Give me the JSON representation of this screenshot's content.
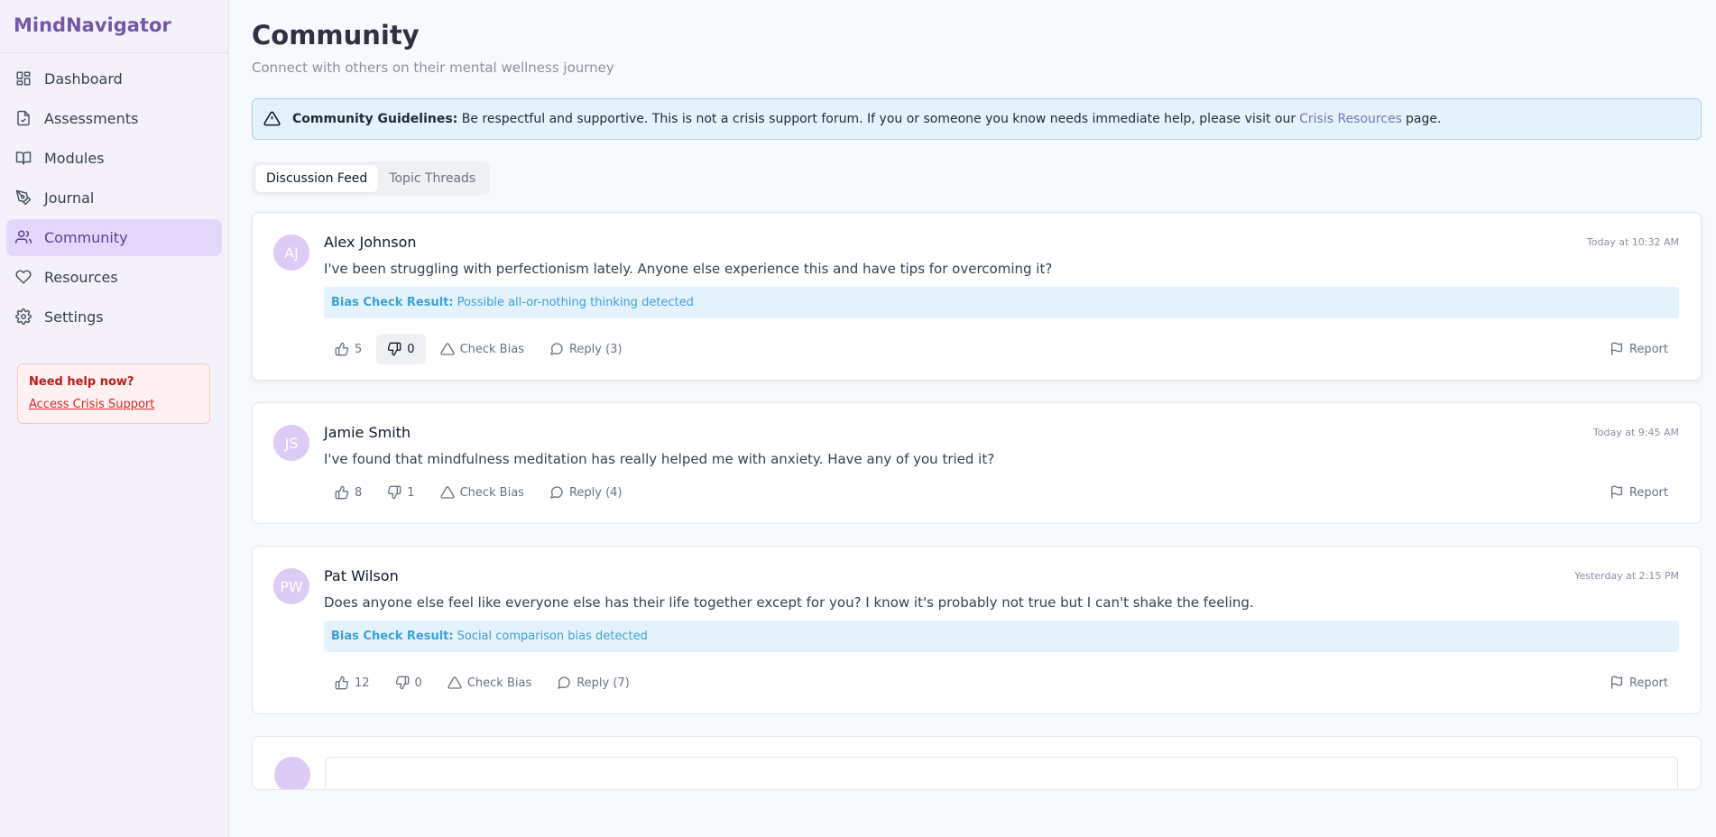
{
  "app": {
    "name": "MindNavigator"
  },
  "sidebar": {
    "items": [
      {
        "label": "Dashboard",
        "icon": "dashboard-icon",
        "active": false
      },
      {
        "label": "Assessments",
        "icon": "document-icon",
        "active": false
      },
      {
        "label": "Modules",
        "icon": "book-icon",
        "active": false
      },
      {
        "label": "Journal",
        "icon": "pen-icon",
        "active": false
      },
      {
        "label": "Community",
        "icon": "users-icon",
        "active": true
      },
      {
        "label": "Resources",
        "icon": "heart-icon",
        "active": false
      },
      {
        "label": "Settings",
        "icon": "gear-icon",
        "active": false
      }
    ],
    "help": {
      "title": "Need help now?",
      "link": "Access Crisis Support"
    }
  },
  "page": {
    "title": "Community",
    "subtitle": "Connect with others on their mental wellness journey"
  },
  "guidelines": {
    "label": "Community Guidelines:",
    "text": "Be respectful and supportive. This is not a crisis support forum. If you or someone you know needs immediate help, please visit our",
    "link": "Crisis Resources",
    "suffix": "page."
  },
  "tabs": [
    {
      "label": "Discussion Feed",
      "active": true
    },
    {
      "label": "Topic Threads",
      "active": false
    }
  ],
  "posts": [
    {
      "initials": "AJ",
      "author": "Alex Johnson",
      "time": "Today at 10:32 AM",
      "content": "I've been struggling with perfectionism lately. Anyone else experience this and have tips for overcoming it?",
      "bias_label": "Bias Check Result:",
      "bias_text": "Possible all-or-nothing thinking detected",
      "likes": "5",
      "dislikes": "0",
      "check_bias": "Check Bias",
      "reply": "Reply (3)",
      "report": "Report"
    },
    {
      "initials": "JS",
      "author": "Jamie Smith",
      "time": "Today at 9:45 AM",
      "content": "I've found that mindfulness meditation has really helped me with anxiety. Have any of you tried it?",
      "likes": "8",
      "dislikes": "1",
      "check_bias": "Check Bias",
      "reply": "Reply (4)",
      "report": "Report"
    },
    {
      "initials": "PW",
      "author": "Pat Wilson",
      "time": "Yesterday at 2:15 PM",
      "content": "Does anyone else feel like everyone else has their life together except for you? I know it's probably not true but I can't shake the feeling.",
      "bias_label": "Bias Check Result:",
      "bias_text": "Social comparison bias detected",
      "likes": "12",
      "dislikes": "0",
      "check_bias": "Check Bias",
      "reply": "Reply (7)",
      "report": "Report"
    }
  ],
  "colors": {
    "brand": "#7257a6",
    "active_nav": "#e3d8fb",
    "bias_text": "#3da0d6",
    "alert_bg": "#e4f2fb",
    "crisis_red": "#dc2626"
  }
}
